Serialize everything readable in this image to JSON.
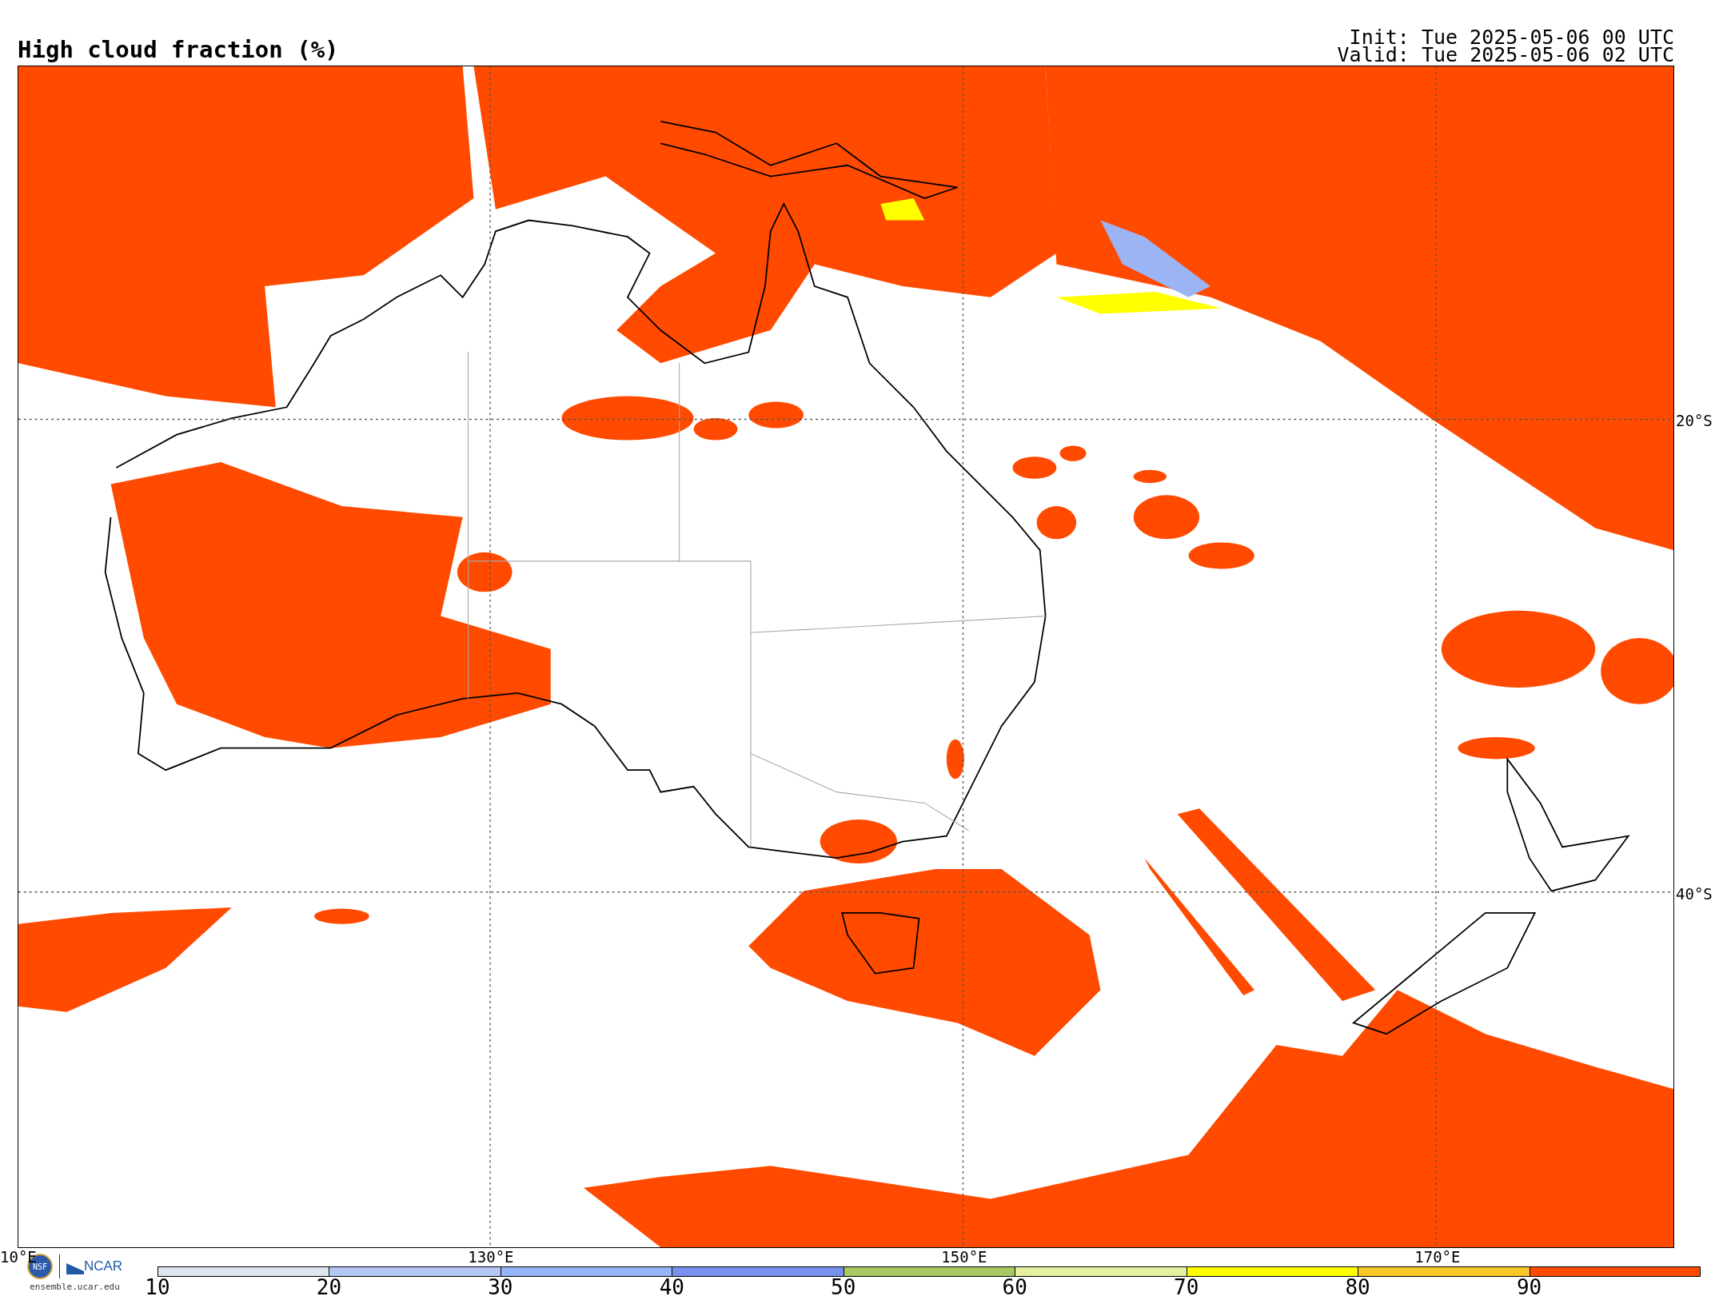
{
  "title": "High cloud fraction (%)",
  "init": "Init: Tue 2025-05-06 00 UTC",
  "valid": "Valid: Tue 2025-05-06 02 UTC",
  "lat_labels": [
    "20°S",
    "40°S"
  ],
  "lon_labels": [
    "10°E",
    "130°E",
    "150°E",
    "170°E"
  ],
  "logos": {
    "nsf": "NSF",
    "ncar": "NCAR",
    "site": "ensemble.ucar.edu"
  },
  "colorbar": [
    {
      "label": "10",
      "color": "#dce6ef"
    },
    {
      "label": "20",
      "color": "#b4c8f5"
    },
    {
      "label": "30",
      "color": "#96b4f8"
    },
    {
      "label": "40",
      "color": "#7890f0"
    },
    {
      "label": "50",
      "color": "#a8c864"
    },
    {
      "label": "60",
      "color": "#e6f0a0"
    },
    {
      "label": "70",
      "color": "#ffff00"
    },
    {
      "label": "80",
      "color": "#f8c828"
    },
    {
      "label": "90",
      "color": "#ff4a00"
    }
  ]
}
